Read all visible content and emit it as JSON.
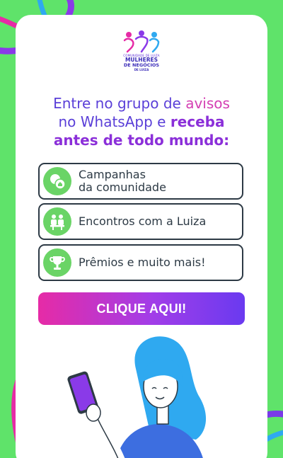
{
  "logo": {
    "small": "COMUNIDADE DE LUIZA",
    "line1": "MULHERES",
    "line2": "DE NEGÓCIOS",
    "line3": "DE LUIZA"
  },
  "headline": {
    "line1_a": "Entre no grupo de ",
    "line1_b": "avisos",
    "line2_a": "no WhatsApp e ",
    "line2_b": "receba",
    "line3": "antes de todo mundo:"
  },
  "features": [
    {
      "line1": "Campanhas",
      "line2": "da comunidade",
      "icon": "chat-bubbles-icon"
    },
    {
      "line1": "Encontros com a Luiza",
      "icon": "meeting-icon"
    },
    {
      "line1": "Prêmios e muito mais!",
      "icon": "trophy-icon"
    }
  ],
  "cta": {
    "label": "CLIQUE AQUI!"
  },
  "colors": {
    "background": "#5fe36a",
    "accent_purple": "#5a3fd8",
    "accent_pink": "#d43fb3",
    "icon_green": "#6ad466",
    "border": "#2d3a45"
  }
}
